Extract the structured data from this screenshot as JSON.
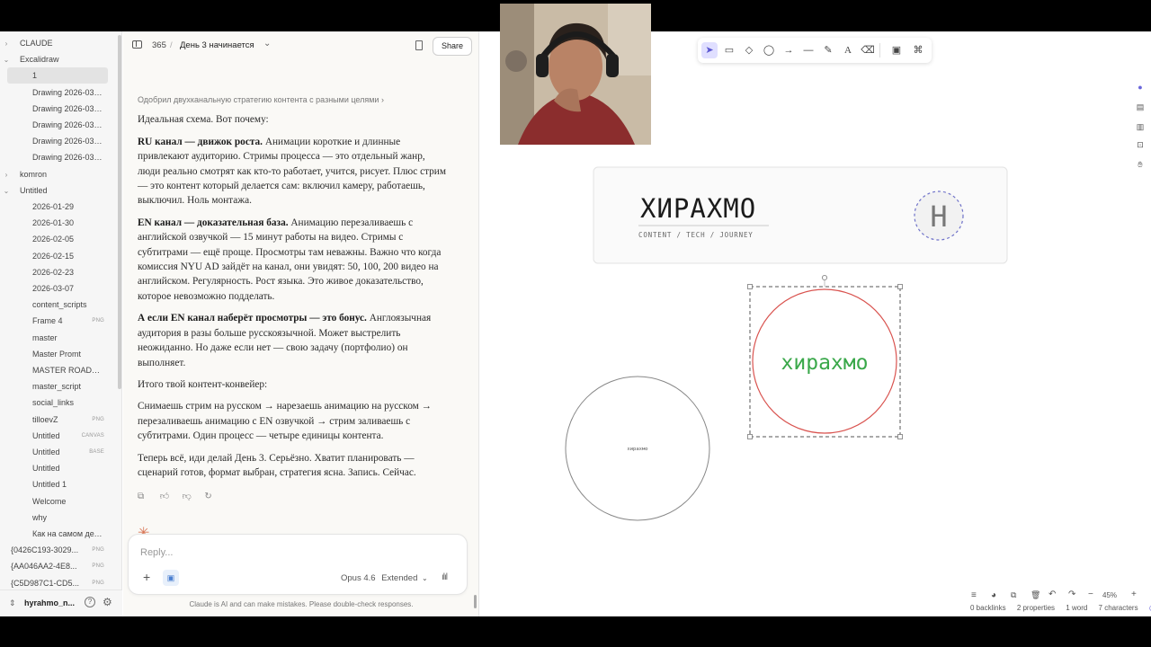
{
  "sidebar": {
    "items": [
      {
        "label": "CLAUDE",
        "chevron": "›",
        "indent": 0
      },
      {
        "label": "Excalidraw",
        "chevron": "⌄",
        "indent": 0
      },
      {
        "label": "1",
        "chevron": "",
        "indent": 1,
        "selected": true
      },
      {
        "label": "Drawing 2026-03-...",
        "chevron": "",
        "indent": 1
      },
      {
        "label": "Drawing 2026-03-...",
        "chevron": "",
        "indent": 1
      },
      {
        "label": "Drawing 2026-03-...",
        "chevron": "",
        "indent": 1
      },
      {
        "label": "Drawing 2026-03-...",
        "chevron": "",
        "indent": 1
      },
      {
        "label": "Drawing 2026-03-...",
        "chevron": "",
        "indent": 1
      },
      {
        "label": "komron",
        "chevron": "›",
        "indent": 0
      },
      {
        "label": "Untitled",
        "chevron": "⌄",
        "indent": 0
      },
      {
        "label": "2026-01-29",
        "chevron": "",
        "indent": 1
      },
      {
        "label": "2026-01-30",
        "chevron": "",
        "indent": 1
      },
      {
        "label": "2026-02-05",
        "chevron": "",
        "indent": 1
      },
      {
        "label": "2026-02-15",
        "chevron": "",
        "indent": 1
      },
      {
        "label": "2026-02-23",
        "chevron": "",
        "indent": 1
      },
      {
        "label": "2026-03-07",
        "chevron": "",
        "indent": 1
      },
      {
        "label": "content_scripts",
        "chevron": "",
        "indent": 1
      },
      {
        "label": "Frame 4",
        "chevron": "",
        "indent": 1,
        "badge": "PNG"
      },
      {
        "label": "master",
        "chevron": "",
        "indent": 1
      },
      {
        "label": "Master Promt",
        "chevron": "",
        "indent": 1
      },
      {
        "label": "MASTER ROADMAP",
        "chevron": "",
        "indent": 1
      },
      {
        "label": "master_script",
        "chevron": "",
        "indent": 1
      },
      {
        "label": "social_links",
        "chevron": "",
        "indent": 1
      },
      {
        "label": "tilloevZ",
        "chevron": "",
        "indent": 1,
        "badge": "PNG"
      },
      {
        "label": "Untitled",
        "chevron": "",
        "indent": 1,
        "badge": "CANVAS"
      },
      {
        "label": "Untitled",
        "chevron": "",
        "indent": 1,
        "badge": "BASE"
      },
      {
        "label": "Untitled",
        "chevron": "",
        "indent": 1
      },
      {
        "label": "Untitled 1",
        "chevron": "",
        "indent": 1
      },
      {
        "label": "Welcome",
        "chevron": "",
        "indent": 1
      },
      {
        "label": "why",
        "chevron": "",
        "indent": 1
      },
      {
        "label": "Как на самом дел...",
        "chevron": "",
        "indent": 1
      },
      {
        "label": "{0426C193-3029...",
        "chevron": "",
        "indent": 0,
        "badge": "PNG"
      },
      {
        "label": "{AA046AA2-4E8...",
        "chevron": "",
        "indent": 0,
        "badge": "PNG"
      },
      {
        "label": "{C5D987C1-CD5...",
        "chevron": "",
        "indent": 0,
        "badge": "PNG"
      }
    ],
    "vault_name": "hyrahmo_n...",
    "footer_icons": [
      "vault-switch-icon",
      "help-icon",
      "settings-icon"
    ]
  },
  "chat": {
    "header": {
      "project_number": "365",
      "separator": "/",
      "title": "День 3 начинается",
      "share_label": "Share"
    },
    "strategy_line": "Одобрил двухканальную стратегию контента с разными целями",
    "strategy_chevron": "›",
    "paragraphs": [
      {
        "text": "Идеальная схема. Вот почему:"
      },
      {
        "bold": "RU канал — движок роста.",
        "text": " Анимации короткие и длинные привлекают аудиторию. Стримы процесса — это отдельный жанр, люди реально смотрят как кто-то работает, учится, рисует. Плюс стрим — это контент который делается сам: включил камеру, работаешь, выключил. Ноль монтажа."
      },
      {
        "bold": "EN канал — доказательная база.",
        "text": " Анимацию перезаливаешь с английской озвучкой — 15 минут работы на видео. Стримы с субтитрами — ещё проще. Просмотры там неважны. Важно что когда комиссия NYU AD зайдёт на канал, они увидят: 50, 100, 200 видео на английском. Регулярность. Рост языка. Это живое доказательство, которое невозможно подделать."
      },
      {
        "bold": "А если EN канал наберёт просмотры — это бонус.",
        "text": " Англоязычная аудитория в разы больше русскоязычной. Может выстрелить неожиданно. Но даже если нет — свою задачу (портфолио) он выполняет."
      },
      {
        "text": "Итого твой контент-конвейер:"
      },
      {
        "text": "Снимаешь стрим на русском → нарезаешь анимацию на русском → перезаливаешь анимацию с EN озвучкой → стрим заливаешь с субтитрами. Один процесс — четыре единицы контента."
      },
      {
        "text": "Теперь всё, иди делай День 3. Серьёзно. Хватит планировать — сценарий готов, формат выбран, стратегия ясна. Запись. Сейчас."
      }
    ],
    "message_actions": [
      "copy-icon",
      "thumbs-up-icon",
      "thumbs-down-icon",
      "retry-icon"
    ],
    "composer": {
      "placeholder": "Reply...",
      "model": "Opus 4.6",
      "mode": "Extended",
      "mode_chevron": "⌄"
    },
    "disclaimer": "Claude is AI and can make mistakes. Please double-check responses."
  },
  "canvas": {
    "toolbar": [
      "select-tool-icon",
      "rectangle-tool-icon",
      "diamond-tool-icon",
      "ellipse-tool-icon",
      "arrow-tool-icon",
      "line-tool-icon",
      "draw-tool-icon",
      "text-tool-icon",
      "eraser-tool-icon",
      "image-tool-icon",
      "extra-tools-icon"
    ],
    "banner": {
      "logo_text": "ХИРАХМО",
      "tagline": "CONTENT / TECH / JOURNEY",
      "monogram": "H"
    },
    "circle_text_green": "хирахмо",
    "circle_text_small": "хирахмо",
    "zoom": "45%",
    "status": {
      "backlinks": "0 backlinks",
      "properties": "2 properties",
      "words": "1 word",
      "characters": "7 characters"
    },
    "colors": {
      "accent": "#6965db",
      "green_text": "#3aa84a",
      "red_circle": "#d9534f",
      "grey_circle": "#888888"
    }
  }
}
